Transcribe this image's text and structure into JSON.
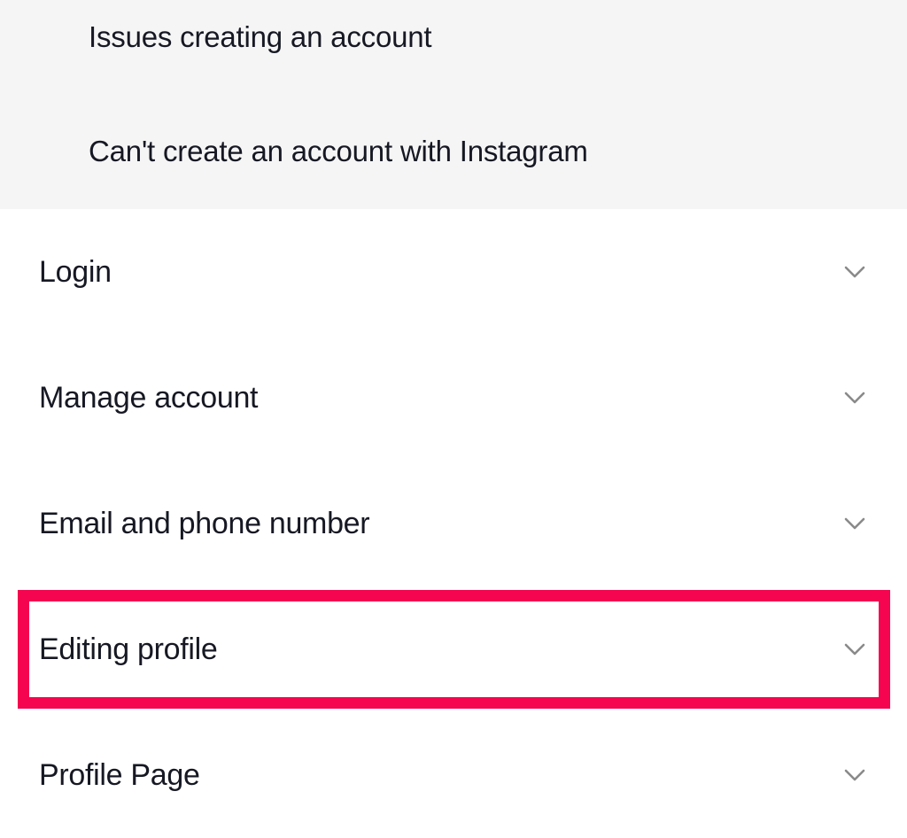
{
  "page": {
    "background_color": "#ffffff",
    "top_panel_color": "#f5f5f5",
    "text_color": "#161823",
    "chevron_color": "#8a8a8a",
    "highlight_color": "#f5054f"
  },
  "top_panel": {
    "links": [
      {
        "label": "Issues creating an account"
      },
      {
        "label": "Can't create an account with Instagram"
      }
    ]
  },
  "accordion": {
    "icon_name": "chevron-down-icon",
    "rows": [
      {
        "label": "Login",
        "expanded": false,
        "highlighted": false
      },
      {
        "label": "Manage account",
        "expanded": false,
        "highlighted": false
      },
      {
        "label": "Email and phone number",
        "expanded": false,
        "highlighted": false
      },
      {
        "label": "Editing profile",
        "expanded": false,
        "highlighted": true
      },
      {
        "label": "Profile Page",
        "expanded": false,
        "highlighted": false
      }
    ]
  },
  "highlight": {
    "target_label": "Editing profile",
    "color": "#f5054f"
  }
}
